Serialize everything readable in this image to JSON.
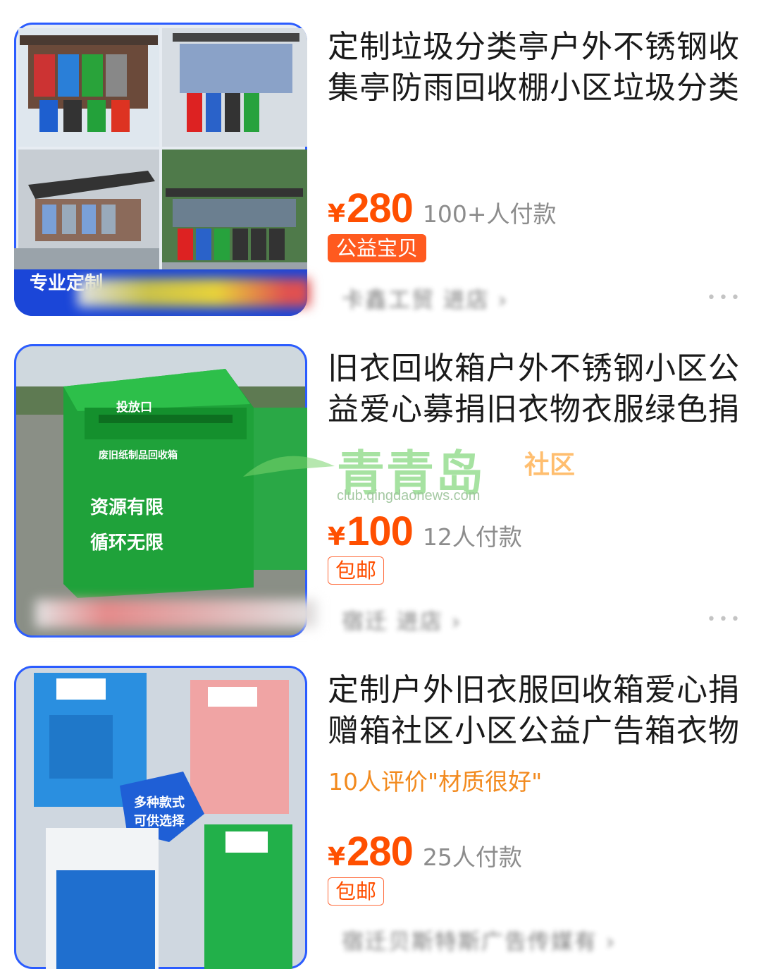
{
  "products": [
    {
      "title": "定制垃圾分类亭户外不锈钢收集亭防雨回收棚小区垃圾分类",
      "currency": "¥",
      "price": "280",
      "sold": "100+人付款",
      "tag": "公益宝贝",
      "shop": "卡鑫工贸 进店 ›",
      "image_overlay": "专业定制"
    },
    {
      "title": "旧衣回收箱户外不锈钢小区公益爱心募捐旧衣物衣服绿色捐",
      "currency": "¥",
      "price": "100",
      "sold": "12人付款",
      "tag": "包邮",
      "shop": "宿迁 进店 ›",
      "image_text_1": "投放口",
      "image_text_2": "废旧纸制品回收箱",
      "image_text_3": "资源有限",
      "image_text_4": "循环无限"
    },
    {
      "title": "定制户外旧衣服回收箱爱心捐赠箱社区小区公益广告箱衣物",
      "review": "10人评价\"材质很好\"",
      "currency": "¥",
      "price": "280",
      "sold": "25人付款",
      "tag": "包邮",
      "shop": "宿迁贝斯特斯广告传媒有 ›",
      "image_badge_1": "多种款式",
      "image_badge_2": "可供选择"
    }
  ],
  "watermark": {
    "main": "青青岛",
    "sub": "社区",
    "url": "club.qingdaonews.com"
  },
  "more_symbol": "•••",
  "colors": {
    "price": "#ff4f00",
    "tag_fill": "#ff5a1f",
    "review": "#f28a1e",
    "thumb_border_blue": "#1677ff"
  }
}
